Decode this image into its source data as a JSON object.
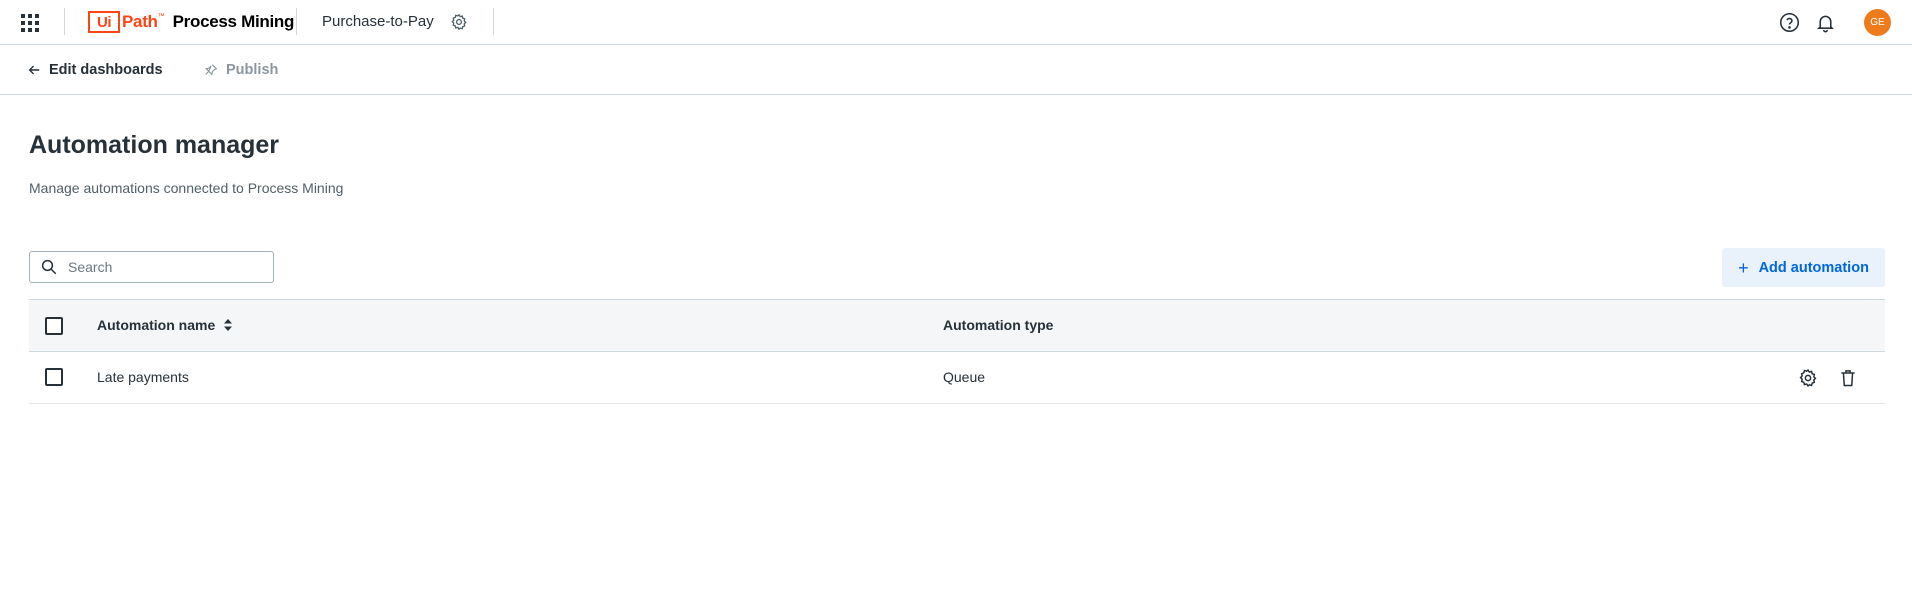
{
  "topbar": {
    "apps_icon": "apps-grid-icon",
    "logo": {
      "mark": "Ui",
      "path": "Path",
      "tm": "™",
      "product": "Process Mining"
    },
    "process_name": "Purchase-to-Pay",
    "process_settings_icon": "gear-icon",
    "help_icon": "help-circle-icon",
    "notifications_icon": "bell-icon",
    "avatar_initials": "GE",
    "avatar_color": "#ee7b1b"
  },
  "subbar": {
    "back_label": "Edit dashboards",
    "back_icon": "arrow-left-icon",
    "publish_label": "Publish",
    "publish_icon": "pin-icon",
    "publish_enabled": false
  },
  "page": {
    "title": "Automation manager",
    "subtitle": "Manage automations connected to Process Mining"
  },
  "search": {
    "placeholder": "Search",
    "value": ""
  },
  "add_button": {
    "label": "Add automation",
    "icon": "plus-icon"
  },
  "table": {
    "columns": [
      {
        "label": "Automation name",
        "sortable": true
      },
      {
        "label": "Automation type"
      }
    ],
    "rows": [
      {
        "name": "Late payments",
        "type": "Queue",
        "actions": [
          "gear-icon",
          "trash-icon"
        ]
      }
    ]
  },
  "colors": {
    "brand": "#fa4616",
    "primary": "#0067df",
    "text": "#273139",
    "muted": "#526069",
    "header_bg": "#f4f6f8",
    "border": "#cfd8dd"
  }
}
